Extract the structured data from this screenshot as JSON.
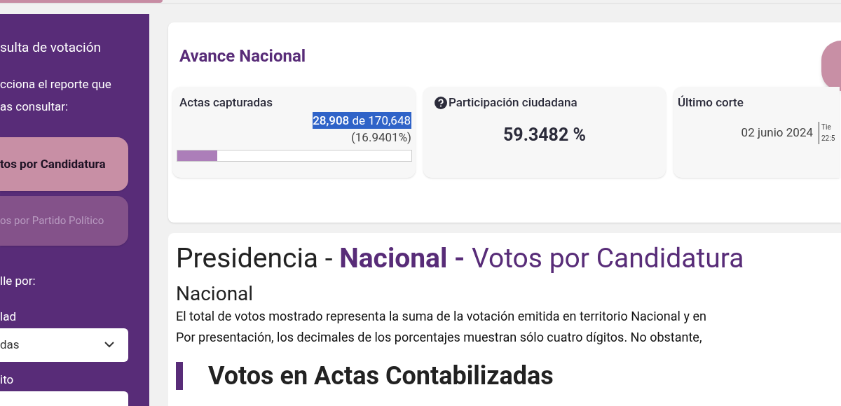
{
  "sidebar": {
    "title": "sulta de votación",
    "prompt": "cciona el reporte que\nas consultar:",
    "reports": [
      {
        "label": "tos por Candidatura",
        "selected": true
      },
      {
        "label": "os por Partido Político",
        "selected": false
      }
    ],
    "detail_label": "lle por:",
    "filters": [
      {
        "label": "lad",
        "value": "das"
      },
      {
        "label": "ito"
      }
    ]
  },
  "summary": {
    "title": "Avance Nacional",
    "actas": {
      "title": "Actas capturadas",
      "count": "28,908",
      "of": "de 170,648",
      "percent": "(16.9401%)",
      "level": 0.169401
    },
    "participacion": {
      "title": "Participación ciudadana",
      "value": "59.3482 %"
    },
    "corte": {
      "title": "Último corte",
      "date": "02 junio 2024",
      "time_label": "Tie",
      "time": "22:5"
    }
  },
  "report": {
    "heading_parts": [
      "Presidencia - ",
      "Nacional -",
      " Votos por Candidatura"
    ],
    "subtitle": "Nacional",
    "notes": [
      "El total de votos mostrado representa la suma de la votación emitida en territorio Nacional y en",
      "Por presentación, los decimales de los porcentajes muestran sólo cuatro dígitos. No obstante,"
    ],
    "section": "Votos en Actas Contabilizadas"
  }
}
